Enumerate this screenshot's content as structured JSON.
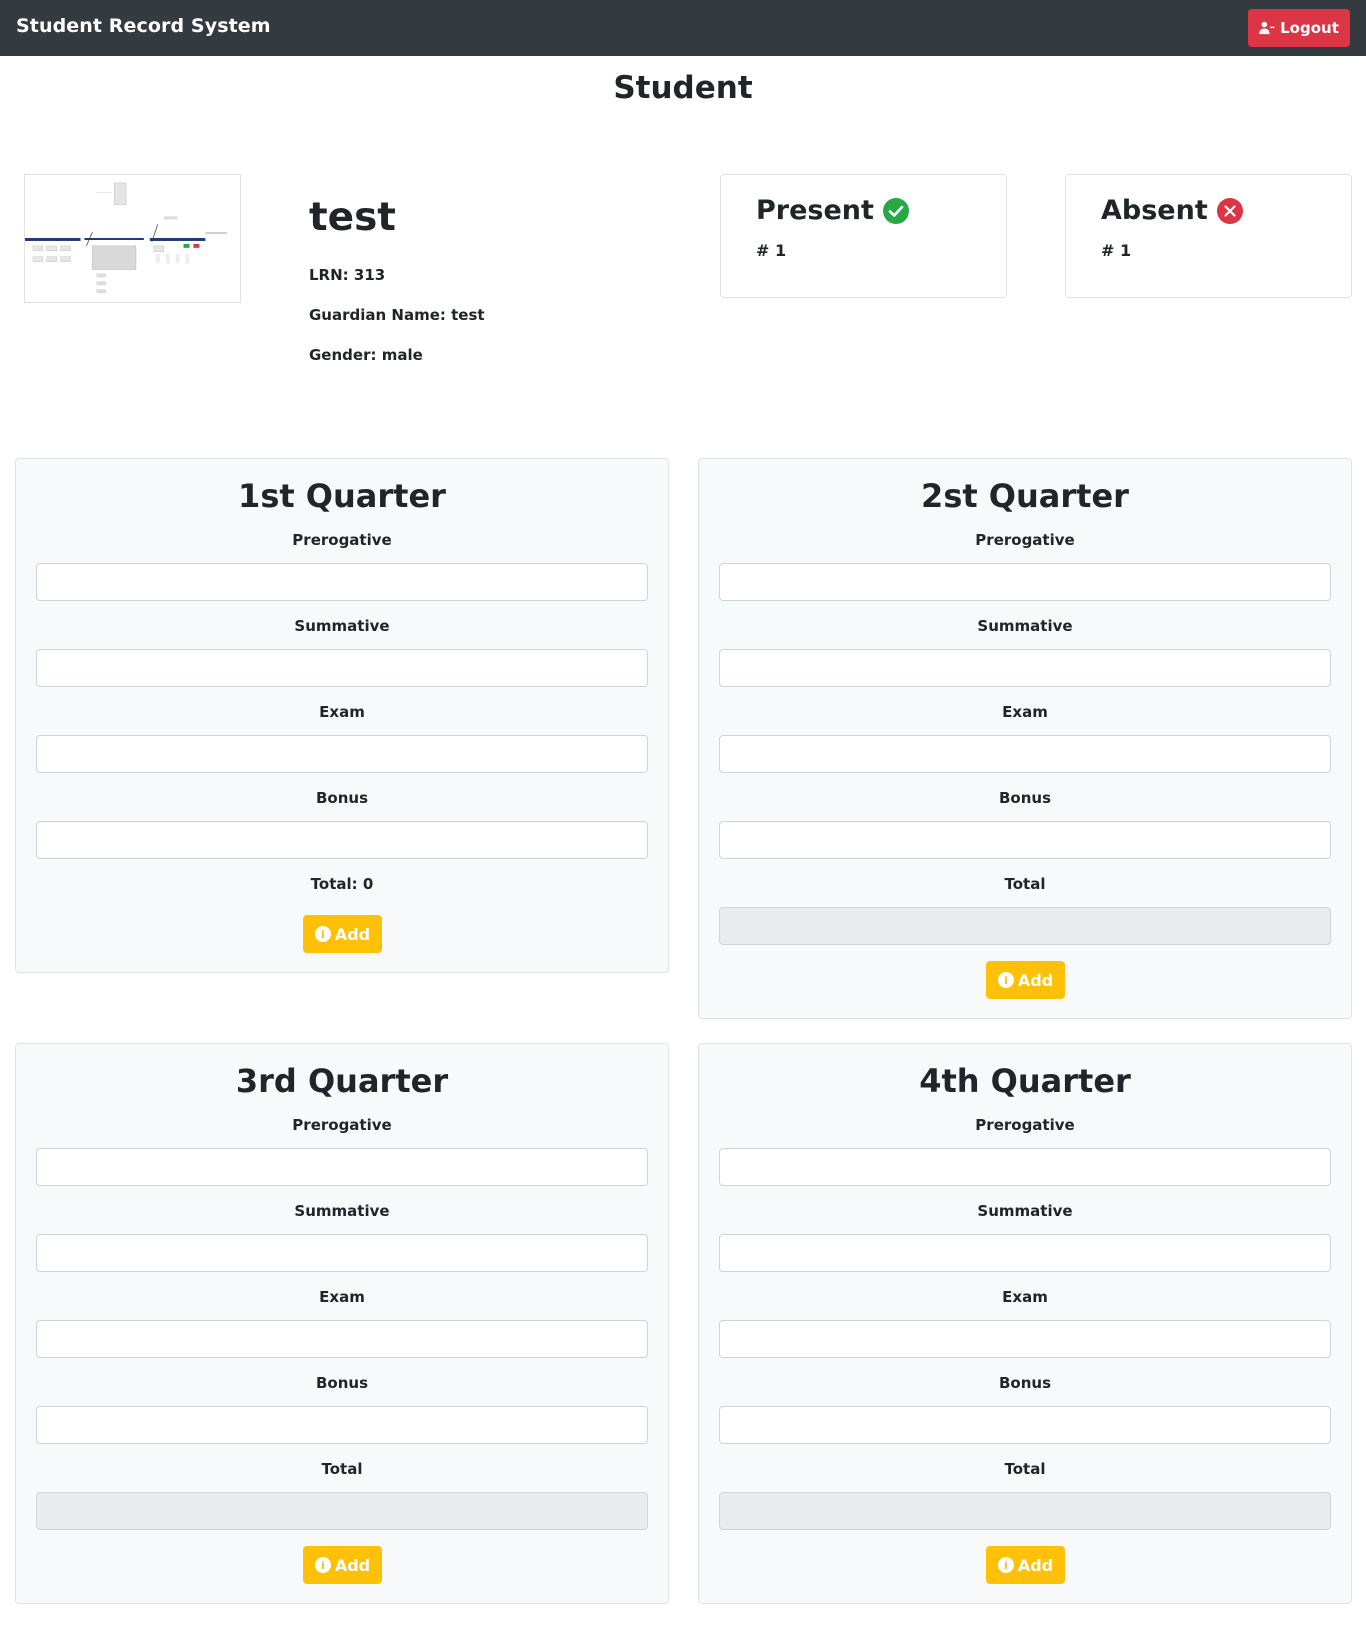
{
  "navbar": {
    "brand": "Student Record System",
    "logout_label": "Logout"
  },
  "page": {
    "title": "Student"
  },
  "student": {
    "name": "test",
    "lrn": "LRN: 313",
    "guardian": "Guardian Name: test",
    "gender": "Gender: male"
  },
  "attendance": {
    "present": {
      "label": "Present",
      "count": "# 1",
      "color": "#28a745"
    },
    "absent": {
      "label": "Absent",
      "count": "# 1",
      "color": "#dc3545"
    }
  },
  "quarters": [
    {
      "title": "1st Quarter",
      "prerogative_label": "Prerogative",
      "summative_label": "Summative",
      "exam_label": "Exam",
      "bonus_label": "Bonus",
      "total_label": "Total: 0",
      "add_label": "Add"
    },
    {
      "title": "2st Quarter",
      "prerogative_label": "Prerogative",
      "summative_label": "Summative",
      "exam_label": "Exam",
      "bonus_label": "Bonus",
      "total_label": "Total",
      "add_label": "Add"
    },
    {
      "title": "3rd Quarter",
      "prerogative_label": "Prerogative",
      "summative_label": "Summative",
      "exam_label": "Exam",
      "bonus_label": "Bonus",
      "total_label": "Total",
      "add_label": "Add"
    },
    {
      "title": "4th Quarter",
      "prerogative_label": "Prerogative",
      "summative_label": "Summative",
      "exam_label": "Exam",
      "bonus_label": "Bonus",
      "total_label": "Total",
      "add_label": "Add"
    }
  ],
  "colors": {
    "navbar": "#343a40",
    "danger": "#dc3545",
    "warning": "#ffc107",
    "success": "#28a745"
  }
}
